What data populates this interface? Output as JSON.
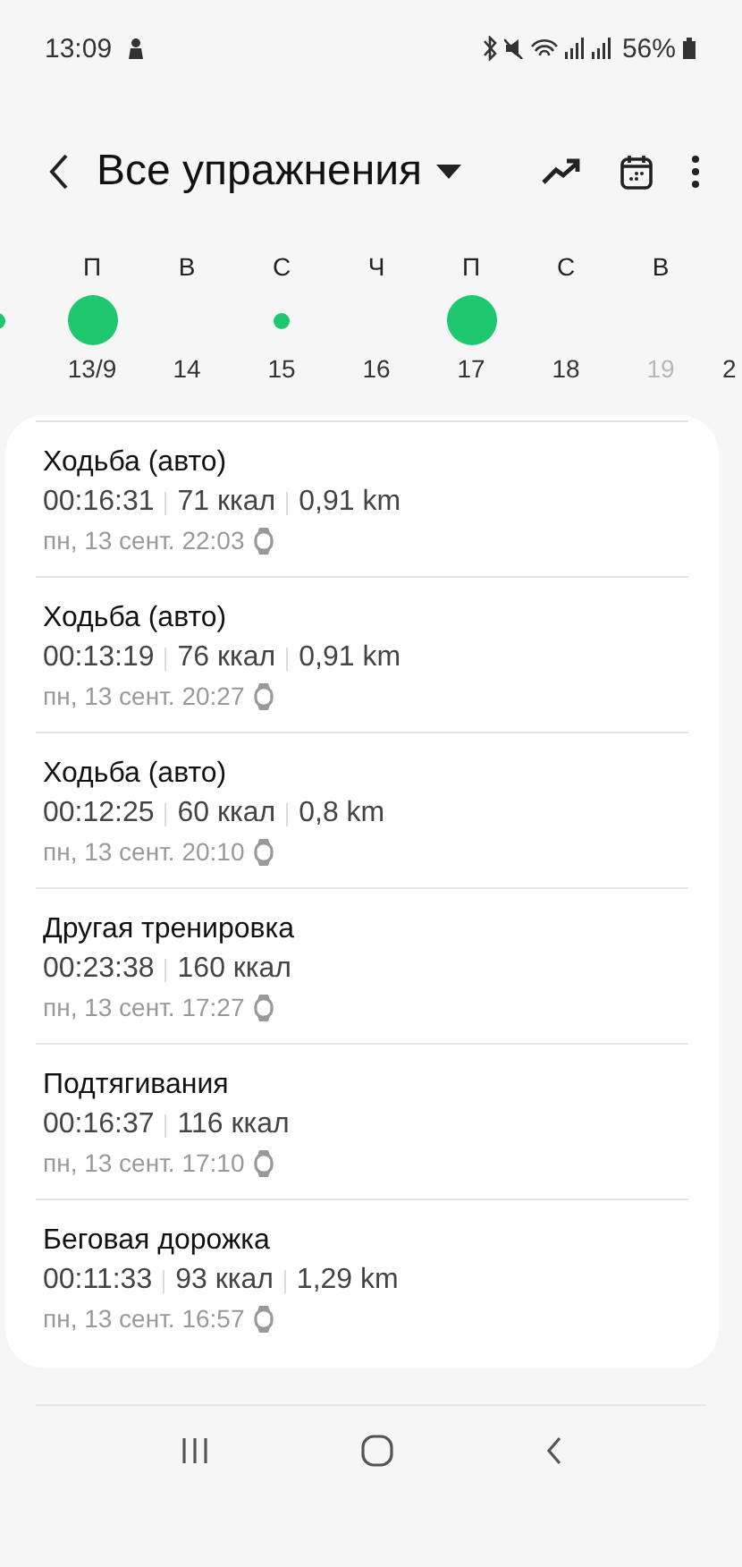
{
  "status_bar": {
    "time": "13:09",
    "battery": "56%"
  },
  "header": {
    "title": "Все упражнения"
  },
  "week": [
    {
      "kind": "small"
    },
    {
      "weekday": "П",
      "date": "13/9",
      "kind": "large",
      "disabled": false
    },
    {
      "weekday": "В",
      "date": "14",
      "kind": "none",
      "disabled": false
    },
    {
      "weekday": "С",
      "date": "15",
      "kind": "small",
      "disabled": false
    },
    {
      "weekday": "Ч",
      "date": "16",
      "kind": "none",
      "disabled": false
    },
    {
      "weekday": "П",
      "date": "17",
      "kind": "large",
      "disabled": false
    },
    {
      "weekday": "С",
      "date": "18",
      "kind": "none",
      "disabled": false
    },
    {
      "weekday": "В",
      "date": "19",
      "kind": "none",
      "disabled": true
    },
    {
      "date": "2",
      "kind": "none",
      "disabled": false
    }
  ],
  "workouts": [
    {
      "name": "Ходьба (авто)",
      "stats": [
        "00:16:31",
        "71 ккал",
        "0,91 km"
      ],
      "time": "пн, 13 сент. 22:03"
    },
    {
      "name": "Ходьба (авто)",
      "stats": [
        "00:13:19",
        "76 ккал",
        "0,91 km"
      ],
      "time": "пн, 13 сент. 20:27"
    },
    {
      "name": "Ходьба (авто)",
      "stats": [
        "00:12:25",
        "60 ккал",
        "0,8 km"
      ],
      "time": "пн, 13 сент. 20:10"
    },
    {
      "name": "Другая тренировка",
      "stats": [
        "00:23:38",
        "160 ккал"
      ],
      "time": "пн, 13 сент. 17:27"
    },
    {
      "name": "Подтягивания",
      "stats": [
        "00:16:37",
        "116 ккал"
      ],
      "time": "пн, 13 сент. 17:10"
    },
    {
      "name": "Беговая дорожка",
      "stats": [
        "00:11:33",
        "93 ккал",
        "1,29 km"
      ],
      "time": "пн, 13 сент. 16:57"
    }
  ]
}
